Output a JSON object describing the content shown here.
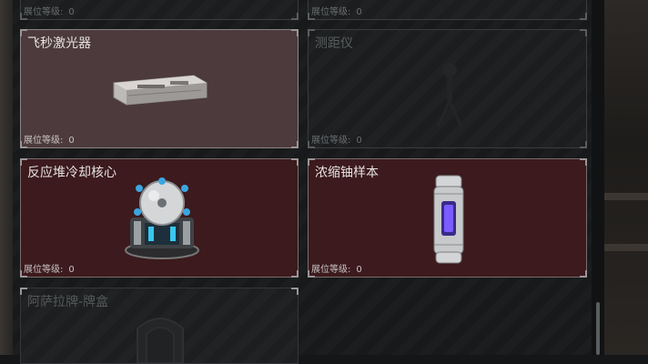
{
  "level_label": "展位等级:",
  "cards": [
    {
      "name": "",
      "level": "0"
    },
    {
      "name": "",
      "level": "0"
    },
    {
      "name": "飞秒激光器",
      "level": "0"
    },
    {
      "name": "测距仪",
      "level": "0"
    },
    {
      "name": "反应堆冷却核心",
      "level": "0"
    },
    {
      "name": "浓缩铀样本",
      "level": "0"
    },
    {
      "name": "阿萨拉牌-牌盒",
      "level": ""
    }
  ],
  "icons": {
    "laser": "femtosecond-laser-icon",
    "rangefinder": "rangefinder-icon",
    "reactor": "reactor-cooling-core-icon",
    "uranium": "enriched-uranium-sample-icon",
    "cardbox": "card-box-icon"
  }
}
